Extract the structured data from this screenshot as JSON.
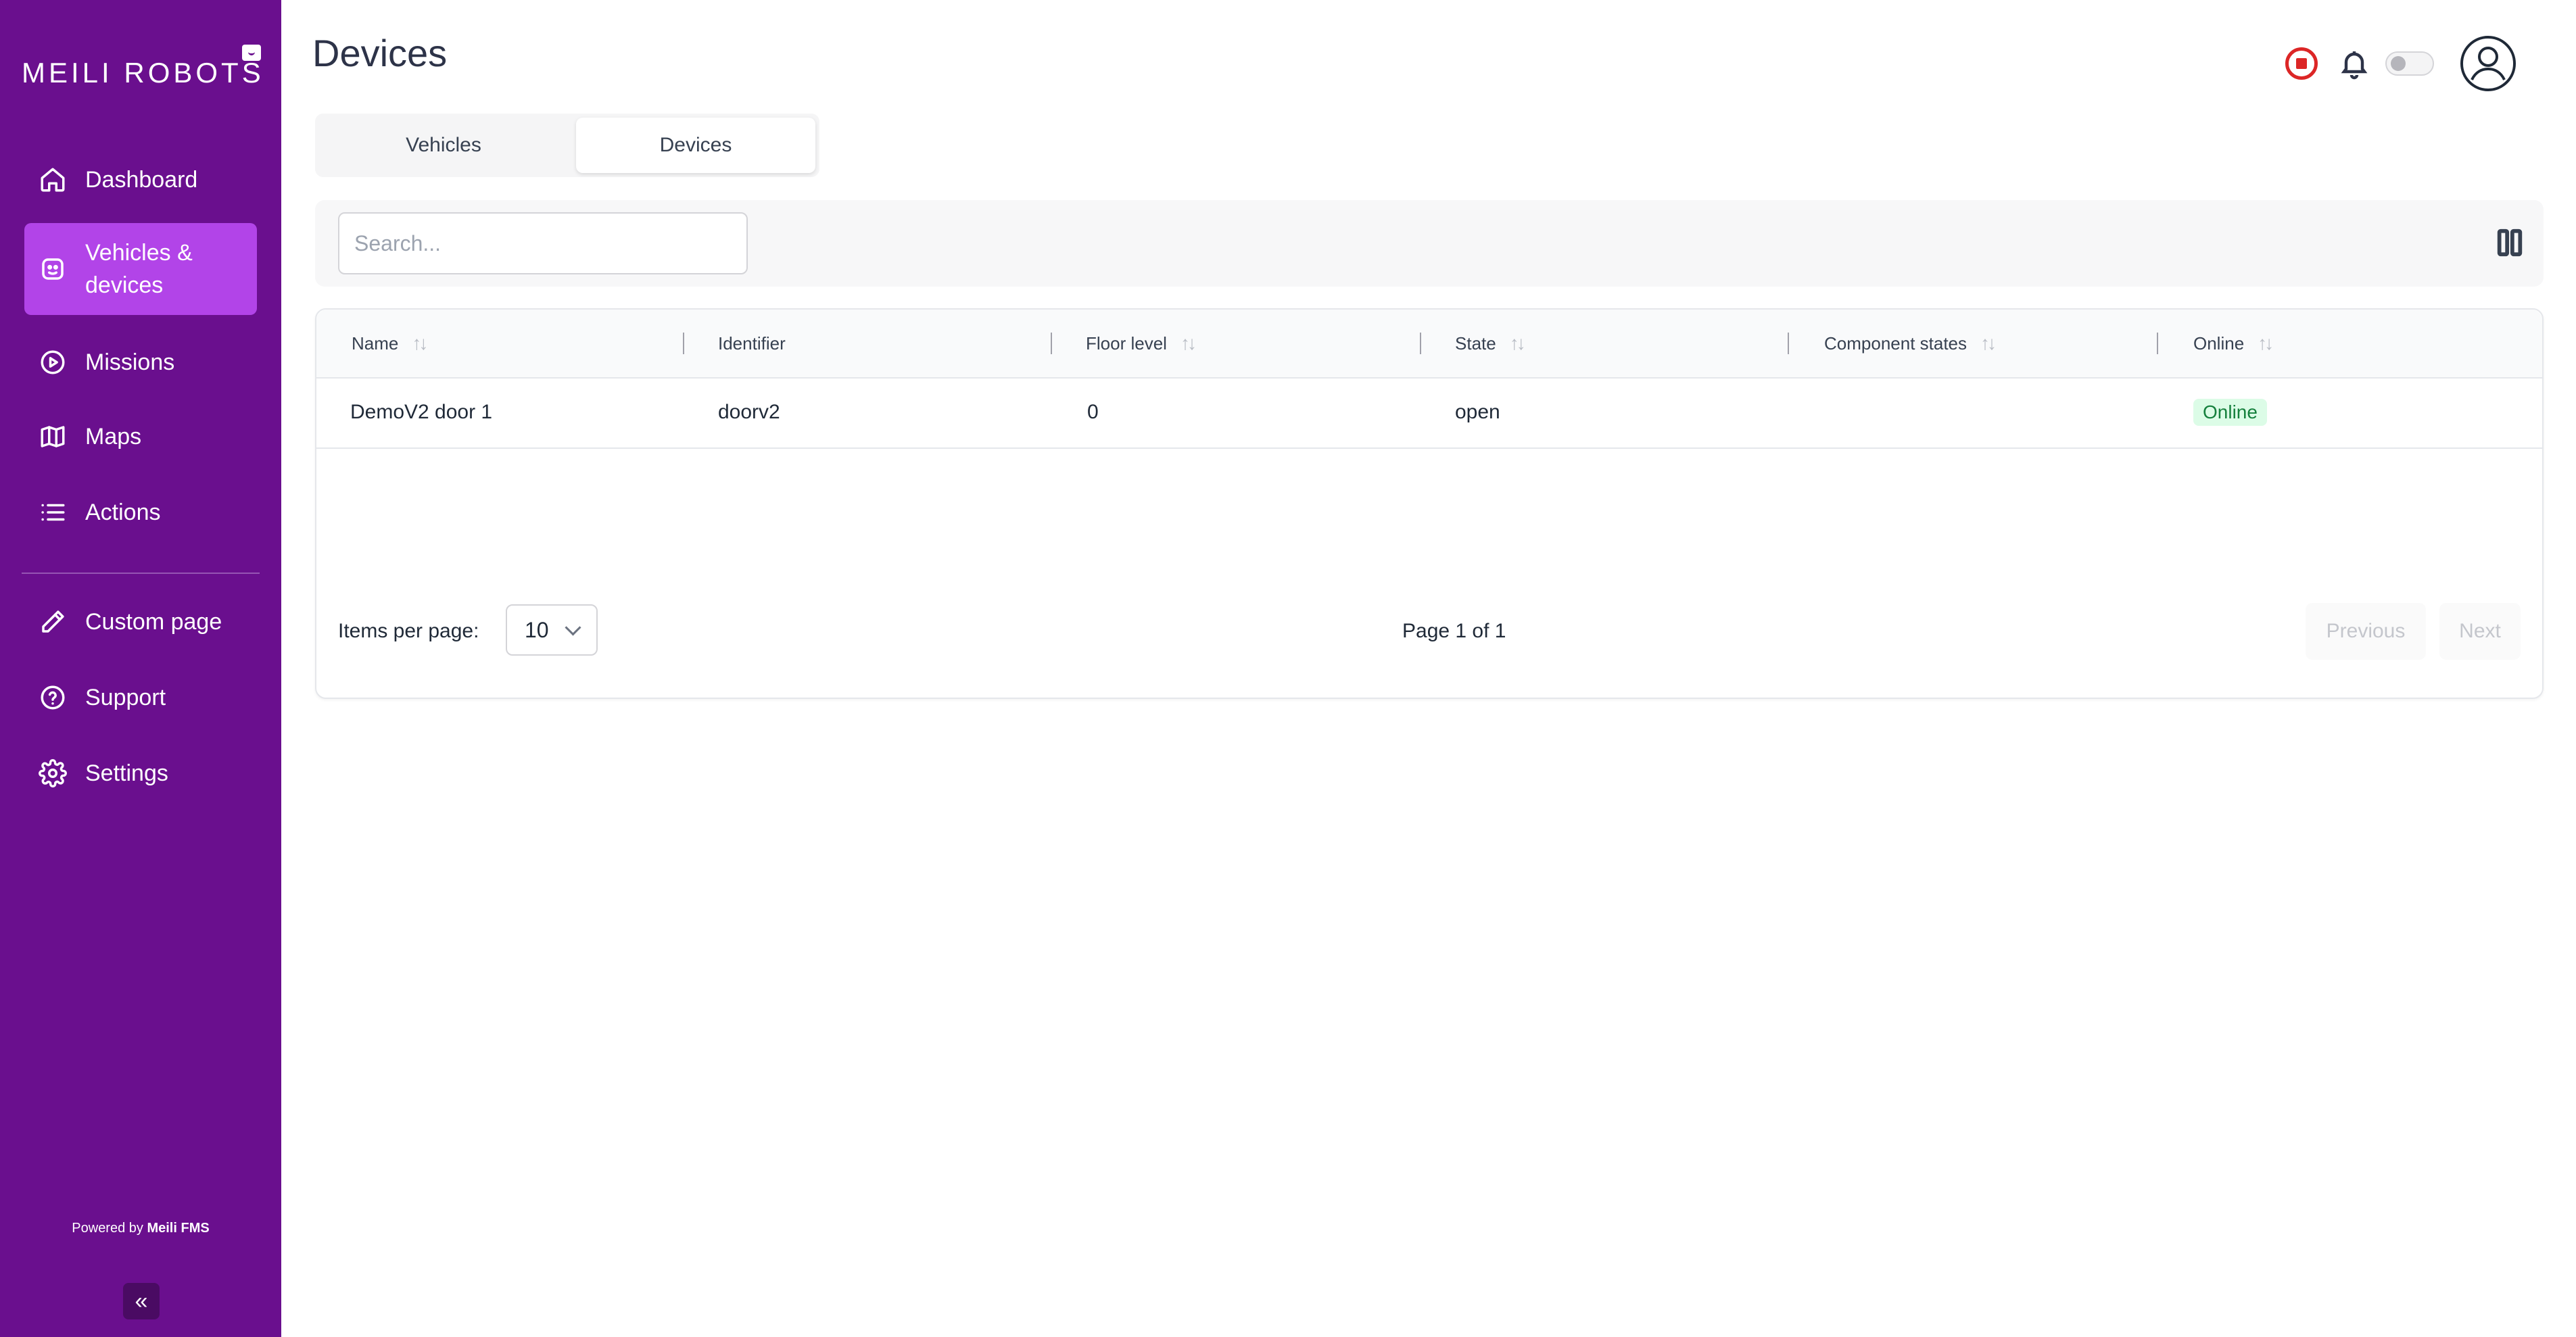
{
  "brand": {
    "logo_text": "MEILI ROBOTS",
    "accent_color": "#6a0f8e",
    "active_color": "#b244e8"
  },
  "sidebar": {
    "items": [
      {
        "label": "Dashboard",
        "icon": "home-icon"
      },
      {
        "label": "Vehicles & devices",
        "icon": "robot-icon",
        "active": true
      },
      {
        "label": "Missions",
        "icon": "play-circle-icon"
      },
      {
        "label": "Maps",
        "icon": "map-icon"
      },
      {
        "label": "Actions",
        "icon": "list-icon"
      },
      {
        "label": "Custom page",
        "icon": "pencil-icon"
      },
      {
        "label": "Support",
        "icon": "help-circle-icon"
      },
      {
        "label": "Settings",
        "icon": "gear-icon"
      }
    ],
    "powered_prefix": "Powered by",
    "powered_brand": "Meili FMS",
    "collapse_glyph": "«"
  },
  "header": {
    "title": "Devices"
  },
  "tabs": [
    {
      "label": "Vehicles",
      "selected": false
    },
    {
      "label": "Devices",
      "selected": true
    }
  ],
  "search": {
    "placeholder": "Search...",
    "value": ""
  },
  "table": {
    "columns": [
      "Name",
      "Identifier",
      "Floor level",
      "State",
      "Component states",
      "Online"
    ],
    "rows": [
      {
        "name": "DemoV2 door 1",
        "identifier": "doorv2",
        "floor_level": "0",
        "state": "open",
        "component_states": "",
        "online": "Online"
      }
    ],
    "online_color": "#15803d"
  },
  "pagination": {
    "items_per_page_label": "Items per page:",
    "items_per_page_value": "10",
    "page_info": "Page 1 of 1",
    "previous_label": "Previous",
    "next_label": "Next"
  }
}
